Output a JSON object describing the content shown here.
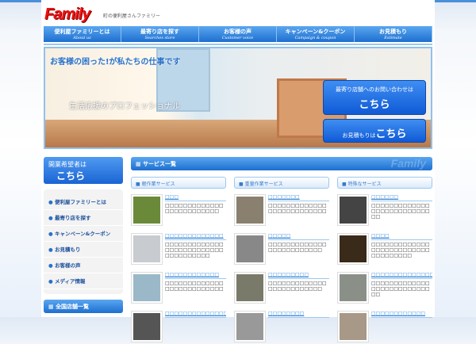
{
  "header": {
    "logo": "Family",
    "tagline": "町の便利屋さんファミリー"
  },
  "nav": [
    {
      "jp": "便利屋ファミリーとは",
      "en": "About us"
    },
    {
      "jp": "最寄り店を探す",
      "en": "Searches store"
    },
    {
      "jp": "お客様の声",
      "en": "Customer voice"
    },
    {
      "jp": "キャンペーン&クーポン",
      "en": "Campaign & coupon"
    },
    {
      "jp": "お見積もり",
      "en": "Estimate"
    }
  ],
  "hero": {
    "headline": "お客様の困った!が私たちの仕事です",
    "sub": "生活応援のプロフェッショナル",
    "cta1_text": "最寄り店舗へのお問い合わせは",
    "cta1_strong": "こちら",
    "cta2_text": "お見積もりは",
    "cta2_strong": "こちら"
  },
  "sidebar": {
    "recruit_text": "開業希望者は",
    "recruit_strong": "こちら",
    "menu": [
      "便利屋ファミリーとは",
      "最寄り店を探す",
      "キャンペーン&クーポン",
      "お見積もり",
      "お客様の声",
      "メディア情報"
    ],
    "stores_heading": "全国店舗一覧"
  },
  "main": {
    "heading": "サービス一覧",
    "watermark": "Family",
    "columns": [
      {
        "title": "軽作業サービス",
        "items": [
          {
            "t": "□□□",
            "d": "□□□□□□□□□□□□□□□□□□□□□□□□□",
            "c": "#6a8a3a"
          },
          {
            "t": "□□□□□□□□□□□□□",
            "d": "□□□□□□□□□□□□□□□□□□□□□□□□□□□□□□□□□□□□",
            "c": "#c8ccd0"
          },
          {
            "t": "□□□□□□□□□□□□",
            "d": "□□□□□□□□□□□□□□□□□□□□□□□□□□",
            "c": "#9ab8c8"
          },
          {
            "t": "□□□□□□□□□□□□□□",
            "d": "",
            "c": "#555"
          }
        ]
      },
      {
        "title": "重量作業サービス",
        "items": [
          {
            "t": "□□□□□□□",
            "d": "□□□□□□□□□□□□□□□□□□□□□□□□□□",
            "c": "#8a8070"
          },
          {
            "t": "□□□□□",
            "d": "□□□□□□□□□□□□□□□□□□□□□□□□□",
            "c": "#888"
          },
          {
            "t": "□□□□□□□□□",
            "d": "□□□□□□□□□□□□□□□□□□□□□□□□□",
            "c": "#7a7a6a"
          },
          {
            "t": "□□□□□□□□",
            "d": "",
            "c": "#999"
          }
        ]
      },
      {
        "title": "特殊なサービス",
        "items": [
          {
            "t": "□□□□□□",
            "d": "□□□□□□□□□□□□□□□□□□□□□□□□□□□□",
            "c": "#444"
          },
          {
            "t": "□□□□",
            "d": "□□□□□□□□□□□□□□□□□□□□□□□□□□□□□□□□□□□",
            "c": "#3a2a1a"
          },
          {
            "t": "□□□□□□□□□□□□□□",
            "d": "□□□□□□□□□□□□□□□□□□□□□□□□□□□□",
            "c": "#8a9088"
          },
          {
            "t": "□□□□□□□□□□□□",
            "d": "",
            "c": "#a89888"
          }
        ]
      }
    ]
  }
}
